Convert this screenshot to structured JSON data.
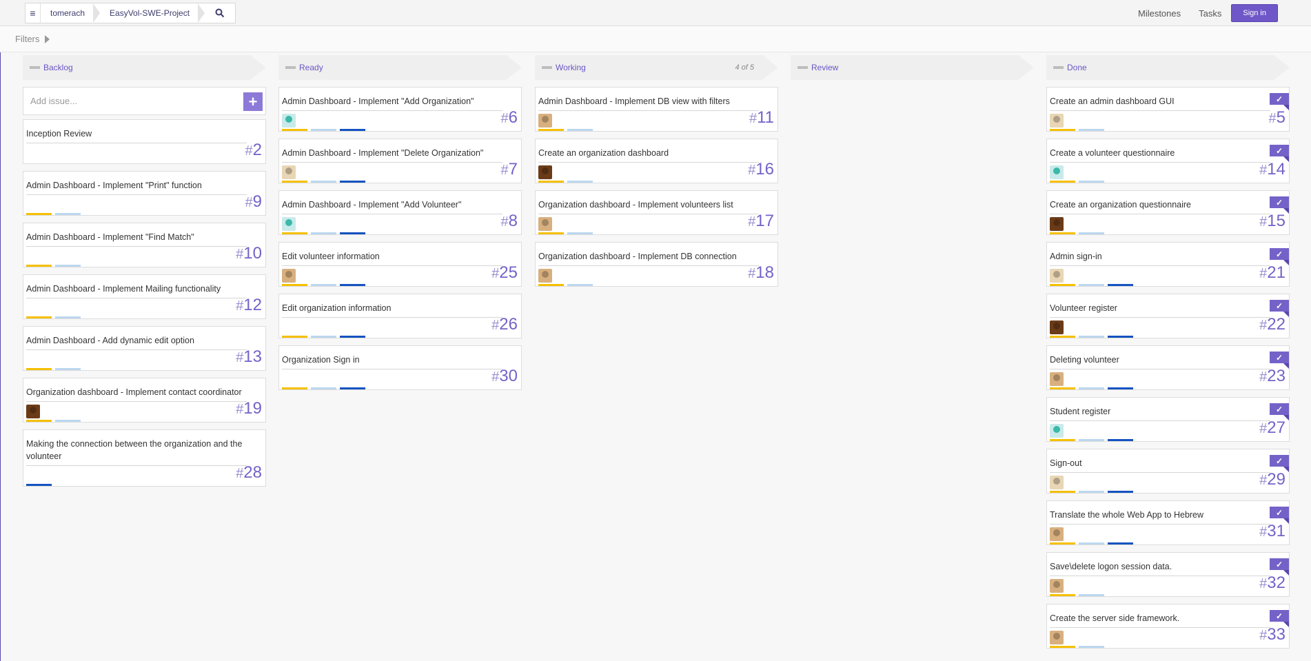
{
  "header": {
    "breadcrumbs": [
      "tomerach",
      "EasyVol-SWE-Project"
    ],
    "nav": {
      "milestones": "Milestones",
      "tasks": "Tasks",
      "signin": "Sign in"
    }
  },
  "filters": {
    "label": "Filters"
  },
  "add_issue": {
    "placeholder": "Add issue..."
  },
  "columns": [
    {
      "title": "Backlog",
      "count": ""
    },
    {
      "title": "Ready",
      "count": ""
    },
    {
      "title": "Working",
      "count": "4 of 5"
    },
    {
      "title": "Review",
      "count": ""
    },
    {
      "title": "Done",
      "count": ""
    }
  ],
  "backlog": [
    {
      "title": "Inception Review",
      "number": "2"
    },
    {
      "title": "Admin Dashboard - Implement \"Print\" function",
      "number": "9"
    },
    {
      "title": "Admin Dashboard - Implement \"Find Match\"",
      "number": "10"
    },
    {
      "title": "Admin Dashboard - Implement Mailing functionality",
      "number": "12"
    },
    {
      "title": "Admin Dashboard - Add dynamic edit option",
      "number": "13"
    },
    {
      "title": "Organization dashboard - Implement contact coordinator",
      "number": "19"
    },
    {
      "title": "Making the connection between the organization and the volunteer",
      "number": "28"
    }
  ],
  "ready": [
    {
      "title": "Admin Dashboard - Implement \"Add Organization\"",
      "number": "6"
    },
    {
      "title": "Admin Dashboard - Implement \"Delete Organization\"",
      "number": "7"
    },
    {
      "title": "Admin Dashboard - Implement \"Add Volunteer\"",
      "number": "8"
    },
    {
      "title": "Edit volunteer information",
      "number": "25"
    },
    {
      "title": "Edit organization information",
      "number": "26"
    },
    {
      "title": "Organization Sign in",
      "number": "30"
    }
  ],
  "working": [
    {
      "title": "Admin Dashboard - Implement DB view with filters",
      "number": "11"
    },
    {
      "title": "Create an organization dashboard",
      "number": "16"
    },
    {
      "title": "Organization dashboard - Implement volunteers list",
      "number": "17"
    },
    {
      "title": "Organization dashboard - Implement DB connection",
      "number": "18"
    }
  ],
  "done": [
    {
      "title": "Create an admin dashboard GUI",
      "number": "5"
    },
    {
      "title": "Create a volunteer questionnaire",
      "number": "14"
    },
    {
      "title": "Create an organization questionnaire",
      "number": "15"
    },
    {
      "title": "Admin sign-in",
      "number": "21"
    },
    {
      "title": "Volunteer register",
      "number": "22"
    },
    {
      "title": "Deleting volunteer",
      "number": "23"
    },
    {
      "title": "Student register",
      "number": "27"
    },
    {
      "title": "Sign-out",
      "number": "29"
    },
    {
      "title": "Translate the whole Web App to Hebrew",
      "number": "31"
    },
    {
      "title": "Save\\delete logon session data.",
      "number": "32"
    },
    {
      "title": "Create the server side framework.",
      "number": "33"
    }
  ],
  "colors": {
    "accent": "#6f57c8",
    "label_yellow": "#f6c000",
    "label_light_blue": "#bcd7ef",
    "label_dark_blue": "#1553c0"
  }
}
